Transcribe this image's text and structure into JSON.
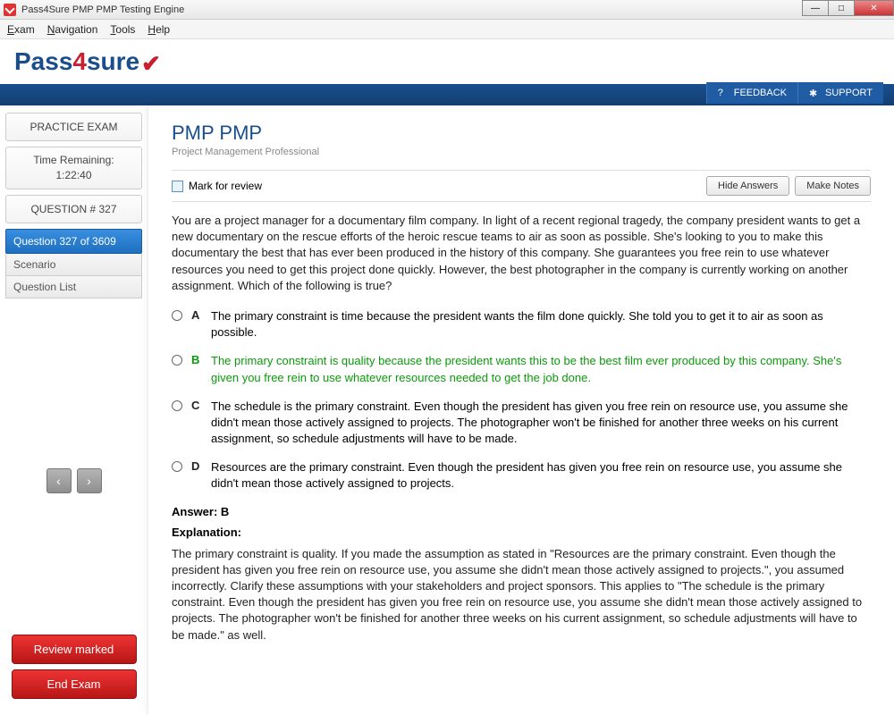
{
  "window": {
    "title": "Pass4Sure PMP PMP Testing Engine"
  },
  "menu": {
    "exam": "Exam",
    "navigation": "Navigation",
    "tools": "Tools",
    "help": "Help"
  },
  "logo": {
    "pass": "Pass",
    "four": "4",
    "sure": "sure",
    "check": "✔"
  },
  "topright": {
    "feedback": "FEEDBACK",
    "support": "SUPPORT"
  },
  "sidebar": {
    "practice": "PRACTICE EXAM",
    "time_label": "Time Remaining:",
    "time_value": "1:22:40",
    "question_num": "QUESTION # 327",
    "active": "Question 327 of 3609",
    "scenario": "Scenario",
    "qlist": "Question List",
    "review_marked": "Review marked",
    "end_exam": "End Exam"
  },
  "main": {
    "title": "PMP PMP",
    "subtitle": "Project Management Professional",
    "mark_review": "Mark for review",
    "hide_answers": "Hide Answers",
    "make_notes": "Make Notes",
    "question_text": "You are a project manager for a documentary film company. In light of a recent regional tragedy, the company president wants to get a new documentary on the rescue efforts of the heroic rescue teams to air as soon as possible. She's looking to you to make this documentary the best that has ever been produced in the history of this company. She guarantees you free rein to use whatever resources you need to get this project done quickly. However, the best photographer in the company is currently working on another assignment. Which of the following is true?",
    "options": {
      "A": "The primary constraint is time because the president wants the film done quickly. She told you to get it to air as soon as possible.",
      "B": "The primary constraint is quality because the president wants this to be the best film ever produced by this company. She's given you free rein to use whatever resources needed to get the job done.",
      "C": "The schedule is the primary constraint. Even though the president has given you free rein on resource use, you assume she didn't mean those actively assigned to projects. The photographer won't be finished for another three weeks on his current assignment, so schedule adjustments will have to be made.",
      "D": "Resources are the primary constraint. Even though the president has given you free rein on resource use, you assume she didn't mean those actively assigned to projects."
    },
    "answer_label": "Answer: B",
    "explanation_label": "Explanation:",
    "explanation": "The primary constraint is quality. If you made the assumption as stated in \"Resources are the primary constraint. Even though the president has given you free rein on resource use, you assume she didn't mean those actively assigned to projects.\", you assumed incorrectly. Clarify these assumptions with your stakeholders and project sponsors. This applies to \"The schedule is the primary constraint. Even though the president has given you free rein on resource use, you assume she didn't mean those actively assigned to projects. The photographer won't be finished for another three weeks on his current assignment, so schedule adjustments will have to be made.\" as well."
  }
}
